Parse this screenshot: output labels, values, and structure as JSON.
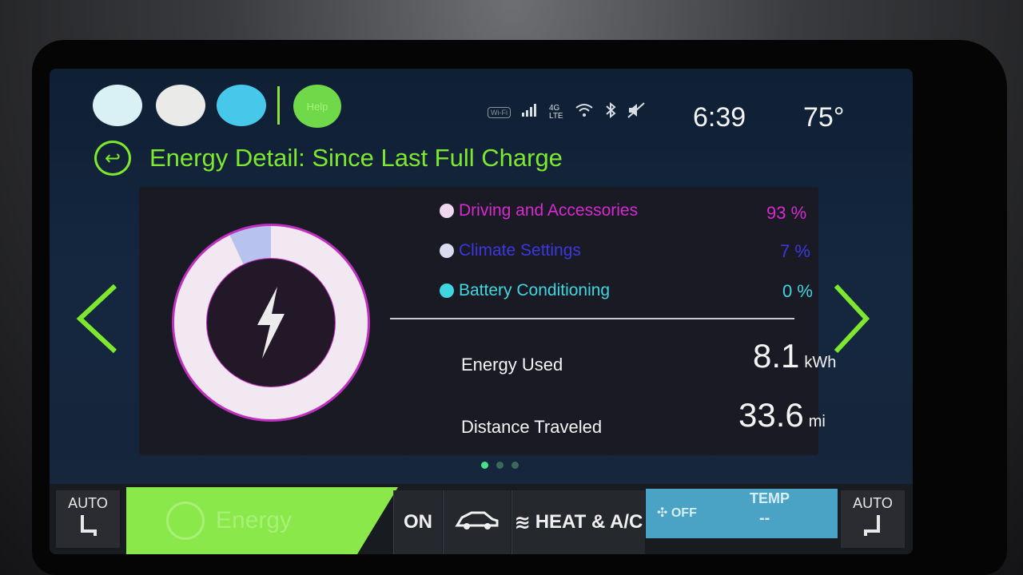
{
  "top_bar": {
    "help_label": "Help",
    "lte_top": "4G",
    "lte_bottom": "LTE",
    "wifi_label": "Wi-Fi",
    "time": "6:39",
    "outside_temp": "75°"
  },
  "title": "Energy Detail: Since Last Full Charge",
  "legend": [
    {
      "label": "Driving and Accessories",
      "percent": "93 %",
      "color": "#d62ad0"
    },
    {
      "label": "Climate Settings",
      "percent": "7 %",
      "color": "#3c38e0"
    },
    {
      "label": "Battery Conditioning",
      "percent": "0 %",
      "color": "#3fd6e0"
    }
  ],
  "donut": {
    "driving_fraction": 0.93,
    "climate_fraction": 0.07,
    "ring_color": "#f2e8f2",
    "climate_color": "#b7c3ee"
  },
  "metrics": {
    "energy_label": "Energy Used",
    "energy_value": "8.1",
    "energy_unit": "kWh",
    "distance_label": "Distance Traveled",
    "distance_value": "33.6",
    "distance_unit": "mi"
  },
  "pager": {
    "pages": 3,
    "active": 0
  },
  "bottom_bar": {
    "left_auto": "AUTO",
    "energy_tab": "Energy",
    "on_label": "ON",
    "heat_ac": "HEAT & A/C",
    "fan_off": "OFF",
    "temp_label": "TEMP",
    "temp_value": "--",
    "right_auto": "AUTO"
  },
  "colors": {
    "accent_green": "#7ee82e"
  }
}
